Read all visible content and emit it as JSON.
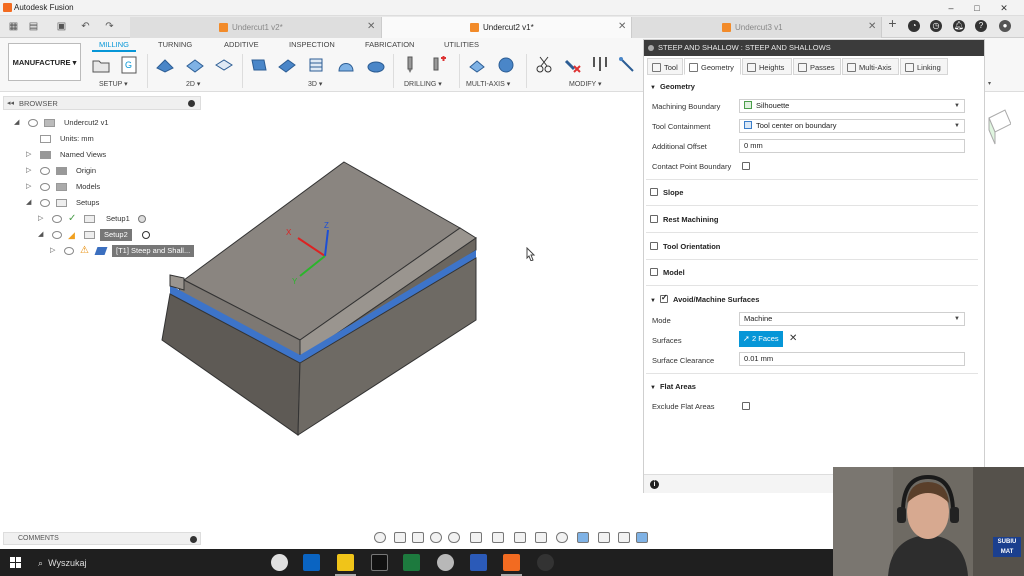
{
  "app": {
    "title": "Autodesk Fusion"
  },
  "tabs": [
    {
      "label": "Undercut1 v2*"
    },
    {
      "label": "Undercut2 v1*"
    },
    {
      "label": "Undercut3 v1"
    }
  ],
  "workspace": {
    "label": "MANUFACTURE"
  },
  "ribbon": {
    "tabs": [
      "MILLING",
      "TURNING",
      "ADDITIVE",
      "INSPECTION",
      "FABRICATION",
      "UTILITIES"
    ],
    "groups": [
      "SETUP",
      "2D",
      "3D",
      "DRILLING",
      "MULTI-AXIS",
      "MODIFY"
    ]
  },
  "browser": {
    "title": "BROWSER",
    "root": "Undercut2 v1",
    "units": "Units: mm",
    "named_views": "Named Views",
    "origin": "Origin",
    "models": "Models",
    "setups": "Setups",
    "setup1": "Setup1",
    "setup2": "Setup2",
    "op": "[T1] Steep and Shall..."
  },
  "comments": {
    "label": "COMMENTS"
  },
  "panel": {
    "title": "STEEP AND SHALLOW : STEEP AND SHALLOWS",
    "tabs": [
      "Tool",
      "Geometry",
      "Heights",
      "Passes",
      "Multi-Axis",
      "Linking"
    ],
    "geometry": {
      "title": "Geometry",
      "machining_boundary_label": "Machining Boundary",
      "machining_boundary_value": "Silhouette",
      "tool_containment_label": "Tool Containment",
      "tool_containment_value": "Tool center on boundary",
      "additional_offset_label": "Additional Offset",
      "additional_offset_value": "0 mm",
      "contact_point_label": "Contact Point Boundary"
    },
    "sections": {
      "slope": "Slope",
      "rest": "Rest Machining",
      "orientation": "Tool Orientation",
      "model": "Model"
    },
    "avoid": {
      "title": "Avoid/Machine Surfaces",
      "mode_label": "Mode",
      "mode_value": "Machine",
      "surfaces_label": "Surfaces",
      "surfaces_value": "2 Faces",
      "clearance_label": "Surface Clearance",
      "clearance_value": "0.01 mm"
    },
    "flat": {
      "title": "Flat Areas",
      "exclude_label": "Exclude Flat Areas"
    }
  },
  "webcam": {
    "badge": "SUBIU MAT"
  },
  "taskbar": {
    "search": "Wyszukaj"
  },
  "colors": {
    "accent": "#0696d7",
    "highlight_band": "#3d74c9"
  }
}
